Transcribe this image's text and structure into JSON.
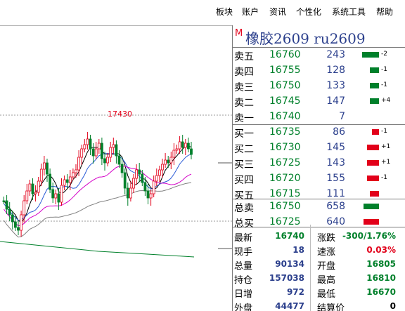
{
  "menu": {
    "items": [
      "板块",
      "账户",
      "资讯",
      "个性化",
      "系统工具",
      "帮助"
    ]
  },
  "chart": {
    "peak_label": "17430",
    "colors": {
      "up": "#e2001a",
      "down": "#00802b",
      "ma_short": "#000000",
      "ma_mid": "#2a5bd7",
      "ma_long": "#d400c8",
      "ma_extra": "#808080",
      "ma_green": "#00802b"
    }
  },
  "quote": {
    "title_mark": "M",
    "title": "橡胶2609 ru2609",
    "asks": [
      {
        "label": "卖五",
        "price": "16760",
        "volume": "243",
        "change": "-2",
        "bar_level": 1.0,
        "bar_color": "#00802b"
      },
      {
        "label": "卖四",
        "price": "16755",
        "volume": "128",
        "change": "-1",
        "bar_level": 0.45,
        "bar_color": "#00802b"
      },
      {
        "label": "卖三",
        "price": "16750",
        "volume": "133",
        "change": "-1",
        "bar_level": 0.45,
        "bar_color": "#00802b"
      },
      {
        "label": "卖二",
        "price": "16745",
        "volume": "147",
        "change": "+4",
        "bar_level": 0.45,
        "bar_color": "#00802b"
      },
      {
        "label": "卖一",
        "price": "16740",
        "volume": "7",
        "change": "",
        "bar_level": 0,
        "bar_color": "#00802b"
      }
    ],
    "bids": [
      {
        "label": "买一",
        "price": "16735",
        "volume": "86",
        "change": "-1",
        "bar_level": 0.3,
        "bar_color": "#e2001a"
      },
      {
        "label": "买二",
        "price": "16730",
        "volume": "145",
        "change": "+1",
        "bar_level": 0.65,
        "bar_color": "#e2001a"
      },
      {
        "label": "买三",
        "price": "16725",
        "volume": "143",
        "change": "+1",
        "bar_level": 0.65,
        "bar_color": "#e2001a"
      },
      {
        "label": "买四",
        "price": "16720",
        "volume": "155",
        "change": "-1",
        "bar_level": 0.65,
        "bar_color": "#e2001a"
      },
      {
        "label": "买五",
        "price": "16715",
        "volume": "111",
        "change": "",
        "bar_level": 0.45,
        "bar_color": "#e2001a"
      }
    ],
    "totals": [
      {
        "label": "总卖",
        "price": "16750",
        "volume": "658",
        "bar_level": 1.0,
        "bar_color": "#00802b"
      },
      {
        "label": "总买",
        "price": "16725",
        "volume": "640",
        "bar_level": 1.0,
        "bar_color": "#e2001a"
      }
    ],
    "stats": [
      {
        "k1": "最新",
        "v1": "16740",
        "c1": "#00802b",
        "k2": "涨跌",
        "v2": "-300/1.76%",
        "c2": "#00802b"
      },
      {
        "k1": "现手",
        "v1": "18",
        "c1": "#2b3f8c",
        "k2": "速涨",
        "v2": "0.03%",
        "c2": "#e2001a"
      },
      {
        "k1": "总量",
        "v1": "90134",
        "c1": "#2b3f8c",
        "k2": "开盘",
        "v2": "16805",
        "c2": "#00802b"
      },
      {
        "k1": "持仓",
        "v1": "157038",
        "c1": "#2b3f8c",
        "k2": "最高",
        "v2": "16810",
        "c2": "#00802b"
      },
      {
        "k1": "日增",
        "v1": "972",
        "c1": "#2b3f8c",
        "k2": "最低",
        "v2": "16670",
        "c2": "#00802b"
      },
      {
        "k1": "外盘",
        "v1": "44477",
        "c1": "#2b3f8c",
        "k2": "结算价",
        "v2": "0",
        "c2": "#000000"
      }
    ]
  }
}
